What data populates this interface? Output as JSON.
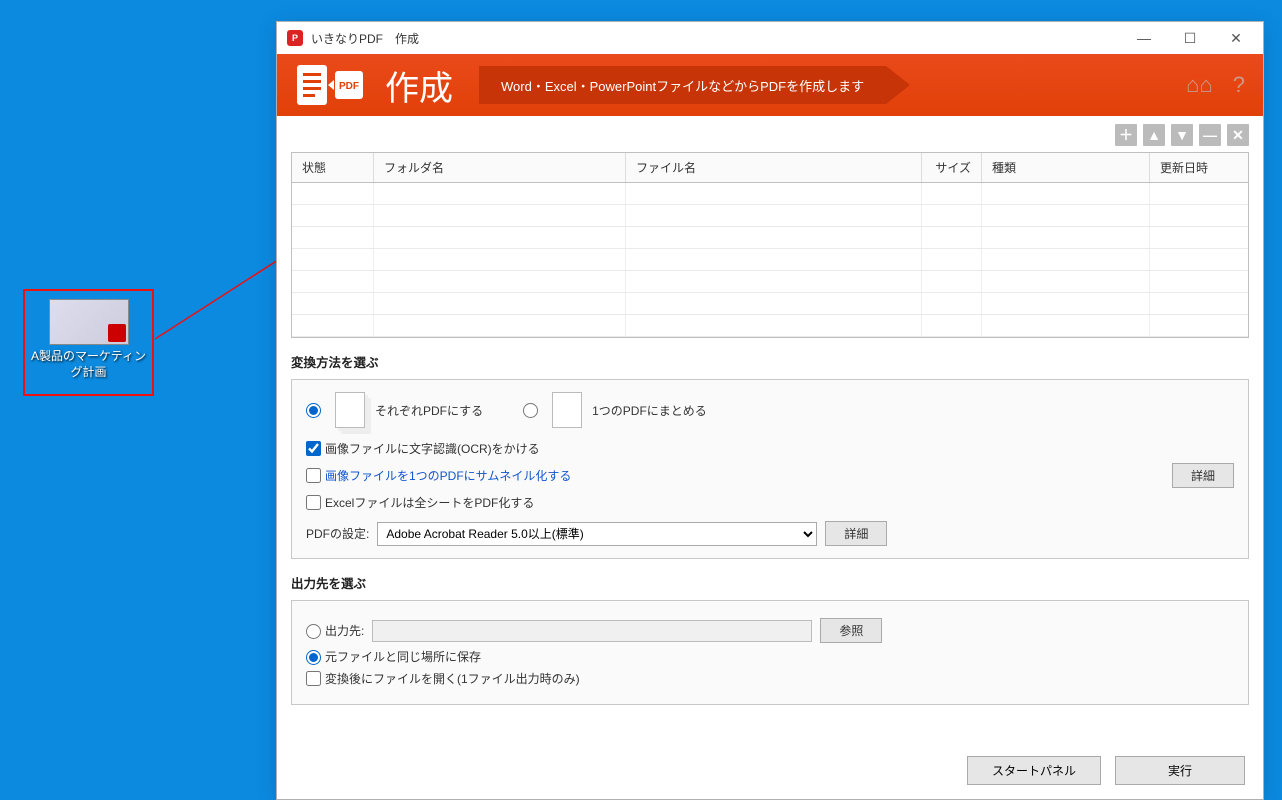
{
  "desktop_icon": {
    "label": "A製品のマーケティング計画"
  },
  "window": {
    "title_app": "いきなりPDF",
    "title_mode": "作成",
    "winbtn": {
      "min": "—",
      "max": "☐",
      "close": "✕"
    }
  },
  "banner": {
    "heading": "作成",
    "subtitle": "Word・Excel・PowerPointファイルなどからPDFを作成します",
    "help_icon": "?",
    "book_icon": "📖"
  },
  "toolbar": {
    "add": "＋",
    "up": "▲",
    "down": "▼",
    "remove": "—",
    "clear": "✕"
  },
  "table": {
    "headers": {
      "status": "状態",
      "folder": "フォルダ名",
      "file": "ファイル名",
      "size": "サイズ",
      "type": "種類",
      "date": "更新日時"
    }
  },
  "conv": {
    "section_title": "変換方法を選ぶ",
    "opt_each": "それぞれPDFにする",
    "opt_merge": "1つのPDFにまとめる",
    "chk_ocr": "画像ファイルに文字認識(OCR)をかける",
    "chk_thumb": "画像ファイルを1つのPDFにサムネイル化する",
    "chk_excel": "Excelファイルは全シートをPDF化する",
    "pdf_label": "PDFの設定:",
    "pdf_option": "Adobe Acrobat Reader 5.0以上(標準)",
    "detail": "詳細"
  },
  "output": {
    "section_title": "出力先を選ぶ",
    "opt_dest": "出力先:",
    "browse": "参照",
    "opt_same": "元ファイルと同じ場所に保存",
    "chk_open": "変換後にファイルを開く(1ファイル出力時のみ)"
  },
  "footer": {
    "start_panel": "スタートパネル",
    "execute": "実行"
  }
}
